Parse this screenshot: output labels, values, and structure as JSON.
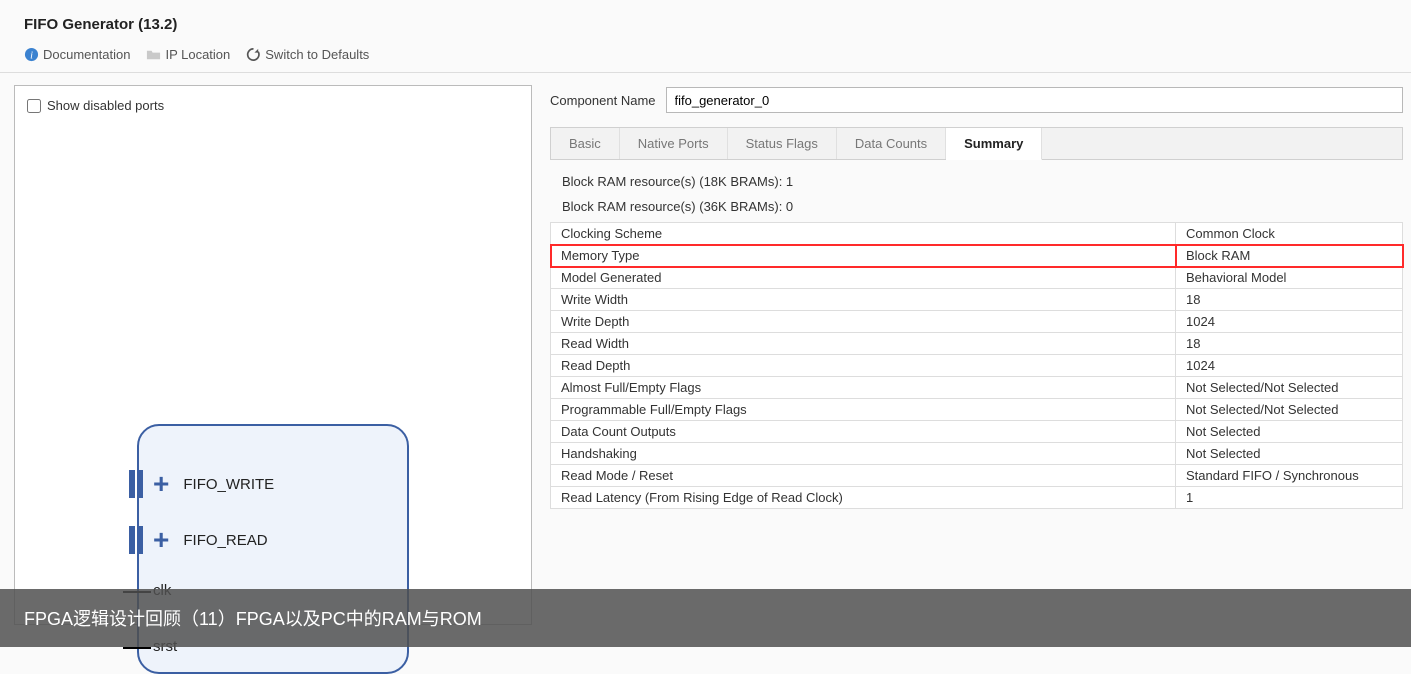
{
  "header": {
    "title": "FIFO Generator (13.2)"
  },
  "toolbar": {
    "doc_label": "Documentation",
    "iploc_label": "IP Location",
    "defaults_label": "Switch to Defaults"
  },
  "left": {
    "show_disabled_label": "Show disabled ports",
    "ports": {
      "bus_write": "FIFO_WRITE",
      "bus_read": "FIFO_READ",
      "clk": "clk",
      "srst": "srst"
    }
  },
  "right": {
    "component_name_label": "Component Name",
    "component_name_value": "fifo_generator_0",
    "tabs": {
      "basic": "Basic",
      "native_ports": "Native Ports",
      "status_flags": "Status Flags",
      "data_counts": "Data Counts",
      "summary": "Summary"
    },
    "resource18": "Block RAM resource(s) (18K BRAMs): 1",
    "resource36": "Block RAM resource(s) (36K BRAMs): 0",
    "rows": [
      {
        "k": "Clocking Scheme",
        "v": "Common Clock"
      },
      {
        "k": "Memory Type",
        "v": "Block RAM",
        "hl": true
      },
      {
        "k": "Model Generated",
        "v": "Behavioral Model"
      },
      {
        "k": "Write Width",
        "v": "18"
      },
      {
        "k": "Write Depth",
        "v": "1024"
      },
      {
        "k": "Read Width",
        "v": "18"
      },
      {
        "k": "Read Depth",
        "v": "1024"
      },
      {
        "k": "Almost Full/Empty Flags",
        "v": "Not Selected/Not Selected"
      },
      {
        "k": "Programmable Full/Empty Flags",
        "v": "Not Selected/Not Selected"
      },
      {
        "k": "Data Count Outputs",
        "v": "Not Selected"
      },
      {
        "k": "Handshaking",
        "v": "Not Selected"
      },
      {
        "k": "Read Mode / Reset",
        "v": "Standard FIFO / Synchronous"
      },
      {
        "k": "Read Latency (From Rising Edge of Read Clock)",
        "v": "1"
      }
    ]
  },
  "caption": "FPGA逻辑设计回顾（11）FPGA以及PC中的RAM与ROM"
}
